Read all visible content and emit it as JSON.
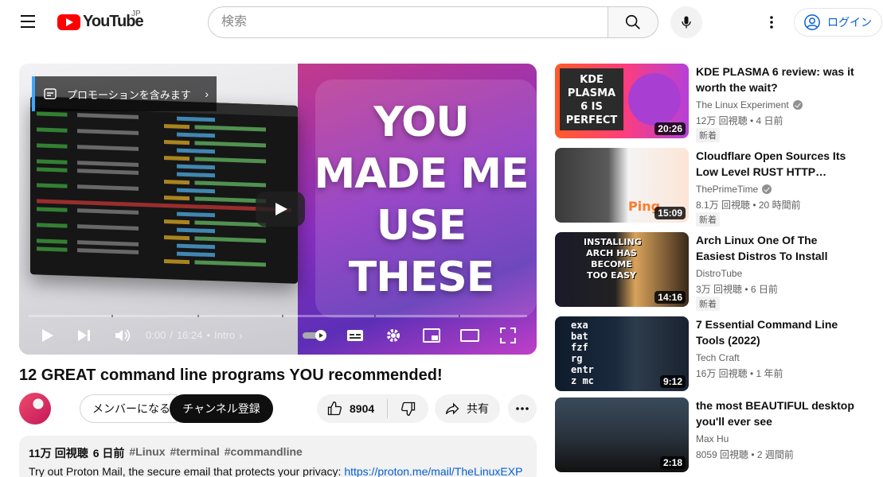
{
  "header": {
    "logo_text": "YouTube",
    "region": "JP",
    "search_placeholder": "検索",
    "login_label": "ログイン"
  },
  "player": {
    "promo_label": "プロモーションを含みます",
    "thumb_lines": [
      "YOU",
      "MADE ME",
      "USE",
      "THESE"
    ],
    "time_current": "0:00",
    "time_separator": "/",
    "time_total": "16:24",
    "chapter": "Intro"
  },
  "video": {
    "title": "12 GREAT command line programs YOU recommended!",
    "member_label": "メンバーになる",
    "subscribe_label": "チャンネル登録",
    "like_count": "8904",
    "share_label": "共有"
  },
  "description": {
    "views": "11万 回視聴",
    "date": "6 日前",
    "tags": [
      "#Linux",
      "#terminal",
      "#commandline"
    ],
    "text": "Try out Proton Mail, the secure email that protects your privacy: ",
    "link": "https://proton.me/mail/TheLinuxEXP"
  },
  "recommendations": [
    {
      "title": "KDE PLASMA 6 review: was it worth the wait?",
      "channel": "The Linux Experiment",
      "verified": true,
      "stats": "12万 回視聴 • 4 日前",
      "badge": "新着",
      "duration": "20:26",
      "thumb_text": "KDE PLASMA 6 IS PERFECT"
    },
    {
      "title": "Cloudflare Open Sources Its Low Level RUST HTTP…",
      "channel": "ThePrimeTime",
      "verified": true,
      "stats": "8.1万 回視聴 • 20 時間前",
      "badge": "新着",
      "duration": "15:09",
      "thumb_text": "Ping"
    },
    {
      "title": "Arch Linux One Of The Easiest Distros To Install",
      "channel": "DistroTube",
      "verified": false,
      "stats": "3万 回視聴 • 6 日前",
      "badge": "新着",
      "duration": "14:16",
      "thumb_text": "INSTALLING ARCH HAS BECOME TOO EASY"
    },
    {
      "title": "7 Essential Command Line Tools (2022)",
      "channel": "Tech Craft",
      "verified": false,
      "stats": "16万 回視聴 • 1 年前",
      "badge": "",
      "duration": "9:12",
      "thumb_text": "exa bat fzf rg entr z mc"
    },
    {
      "title": "the most BEAUTIFUL desktop you'll ever see",
      "channel": "Max Hu",
      "verified": false,
      "stats": "8059 回視聴 • 2 週間前",
      "badge": "",
      "duration": "2:18",
      "thumb_text": ""
    }
  ],
  "colors": {
    "accent": "#065fd4",
    "youtube_red": "#ff0000"
  }
}
